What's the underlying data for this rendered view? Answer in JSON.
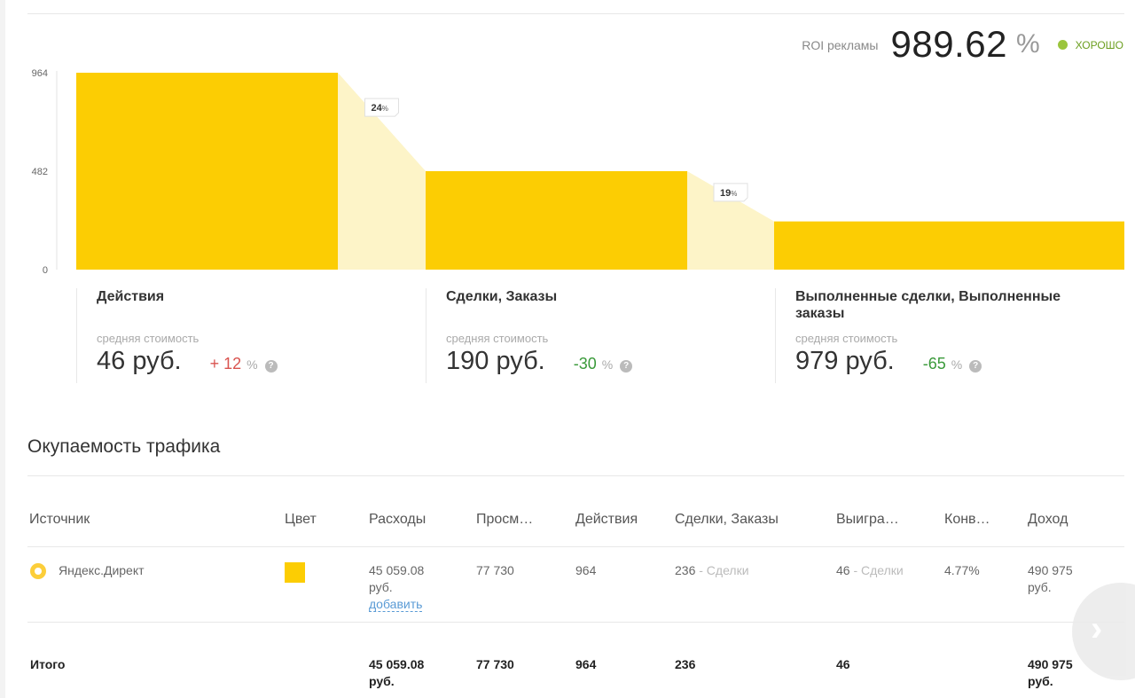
{
  "roi": {
    "label": "ROI рекламы",
    "value": "989.62",
    "unit": "%",
    "status": "ХОРОШО"
  },
  "colors": {
    "bar": "#fccd03",
    "band": "#fdf4c8",
    "good": "#9bc53d"
  },
  "chart_data": {
    "type": "bar",
    "categories": [
      "Действия",
      "Сделки, Заказы",
      "Выполненные сделки, Выполненные заказы"
    ],
    "values": [
      964,
      482,
      236
    ],
    "ylim": [
      0,
      964
    ],
    "yticks": [
      "0",
      "482",
      "964"
    ],
    "conversions": [
      "24",
      "19"
    ],
    "conversion_unit": "%",
    "grid": false
  },
  "stages": [
    {
      "title": "Действия",
      "subtitle": "средняя стоимость",
      "cost": "46 руб.",
      "diff": "+ 12",
      "diff_unit": "%",
      "help": "?"
    },
    {
      "title": "Сделки, Заказы",
      "subtitle": "средняя стоимость",
      "cost": "190 руб.",
      "diff": "-30",
      "diff_unit": "%",
      "help": "?"
    },
    {
      "title": "Выполненные сделки, Выполненные заказы",
      "subtitle": "средняя стоимость",
      "cost": "979 руб.",
      "diff": "-65",
      "diff_unit": "%",
      "help": "?"
    }
  ],
  "traffic": {
    "title": "Окупаемость трафика",
    "headers": [
      "Источник",
      "Цвет",
      "Расходы",
      "Просм…",
      "Действия",
      "Сделки, Заказы",
      "Выигра…",
      "Конв…",
      "Доход"
    ],
    "row": {
      "source": "Яндекс.Директ",
      "expenses": "45 059.08",
      "expenses_unit": "руб.",
      "add_link": "добавить",
      "views": "77 730",
      "actions": "964",
      "deals": "236",
      "deals_note": " - Сделки",
      "won": "46",
      "won_note": " - Сделки",
      "conv": "4.77%",
      "income": "490 975",
      "income_unit": "руб."
    },
    "total": {
      "label": "Итого",
      "expenses": "45 059.08",
      "expenses_unit": "руб.",
      "views": "77 730",
      "actions": "964",
      "deals": "236",
      "won": "46",
      "income": "490 975",
      "income_unit": "руб."
    }
  },
  "nav": {
    "next_icon": "chevron-right-icon",
    "glyph": "›"
  }
}
